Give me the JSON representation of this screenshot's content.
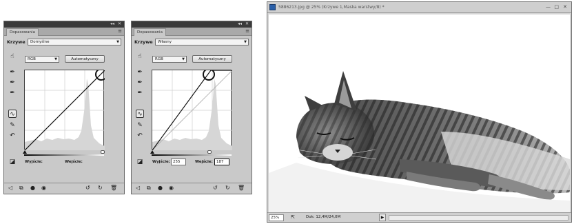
{
  "panels": [
    {
      "tab": "Dopasowania",
      "title": "Krzywe",
      "preset": "Domyślne",
      "channel": "RGB",
      "auto_button": "Automatyczny",
      "output_label": "Wyjście:",
      "input_label": "Wejście:",
      "output_value": "",
      "input_value": ""
    },
    {
      "tab": "Dopasowania",
      "title": "Krzywe",
      "preset": "Własny",
      "channel": "RGB",
      "auto_button": "Automatyczny",
      "output_label": "Wyjście:",
      "input_label": "Wejście:",
      "output_value": "255",
      "input_value": "187"
    }
  ],
  "document": {
    "title": "5886213.jpg @ 25% (Krzywe 1,Maska warstwy/8) *",
    "zoom": "25%",
    "doc_info": "Dok: 12,4M/24,0M"
  },
  "icons": {
    "window_min": "minimize-icon",
    "window_max": "maximize-icon",
    "window_close": "close-icon"
  }
}
